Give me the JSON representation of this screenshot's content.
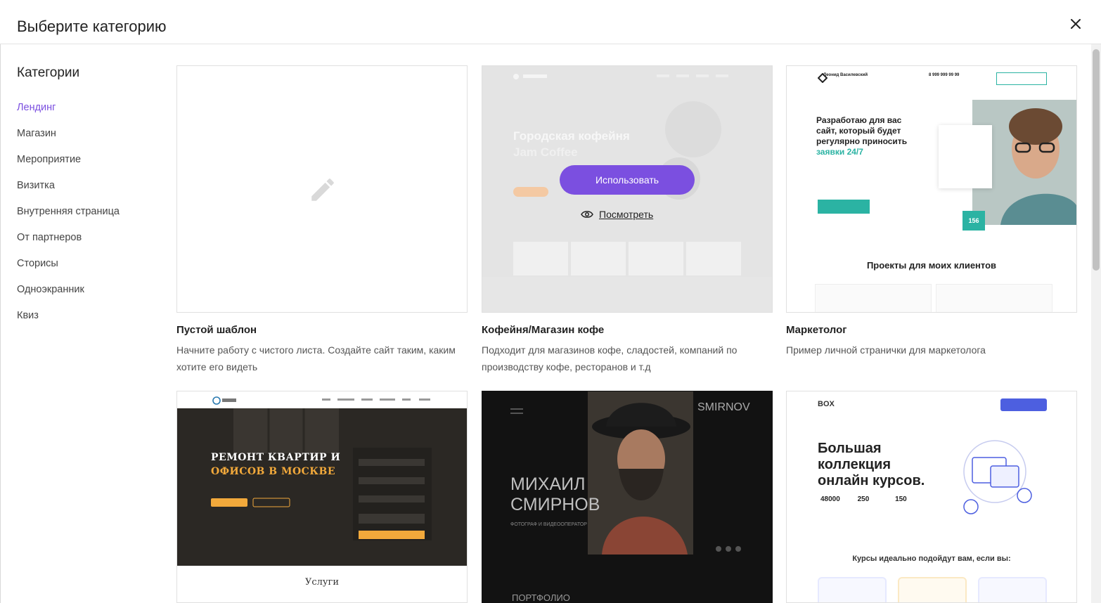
{
  "header": {
    "title": "Выберите категорию"
  },
  "sidebar": {
    "title": "Категории",
    "items": [
      {
        "label": "Лендинг",
        "active": true
      },
      {
        "label": "Магазин"
      },
      {
        "label": "Мероприятие"
      },
      {
        "label": "Визитка"
      },
      {
        "label": "Внутренняя страница"
      },
      {
        "label": "От партнеров"
      },
      {
        "label": "Сторисы"
      },
      {
        "label": "Одноэкранник"
      },
      {
        "label": "Квиз"
      }
    ]
  },
  "cards": [
    {
      "title": "Пустой шаблон",
      "desc": "Начните работу с чистого листа. Создайте сайт таким, каким хотите его видеть"
    },
    {
      "title": "Кофейня/Магазин кофе",
      "desc": "Подходит для магазинов кофе, сладостей, компаний по производству кофе, ресторанов и т.д",
      "preview": {
        "headline": "Городская кофейня",
        "brand": "Jam Coffee",
        "use_label": "Использовать",
        "view_label": "Посмотреть"
      }
    },
    {
      "title": "Маркетолог",
      "desc": "Пример личной странички для маркетолога",
      "preview": {
        "name": "Леонид Василевский",
        "phone": "8 999 999 99 99",
        "headline": "Разработаю для вас сайт, который будет регулярно приносить",
        "accent": "заявки 24/7",
        "projects": "Проекты для моих клиентов",
        "badge": "156"
      }
    },
    {
      "preview": {
        "title1": "РЕМОНТ КВАРТИР И",
        "title2": "ОФИСОВ В МОСКВЕ",
        "services": "Услуги"
      }
    },
    {
      "preview": {
        "brand": "SMIRNOV",
        "name1": "МИХАИЛ",
        "name2": "СМИРНОВ",
        "sub": "ФОТОГРАФ И ВИДЕООПЕРАТОР",
        "portfolio": "ПОРТФОЛИО"
      }
    },
    {
      "preview": {
        "logo": "BOX",
        "title1": "Большая",
        "title2": "коллекция",
        "title3": "онлайн курсов.",
        "stat1": "48000",
        "stat2": "250",
        "stat3": "150",
        "sub": "Курсы идеально подойдут вам, если вы:"
      }
    }
  ],
  "colors": {
    "accent": "#7b4fe0",
    "teal": "#2bb3a3",
    "blue": "#4d5fe0"
  }
}
